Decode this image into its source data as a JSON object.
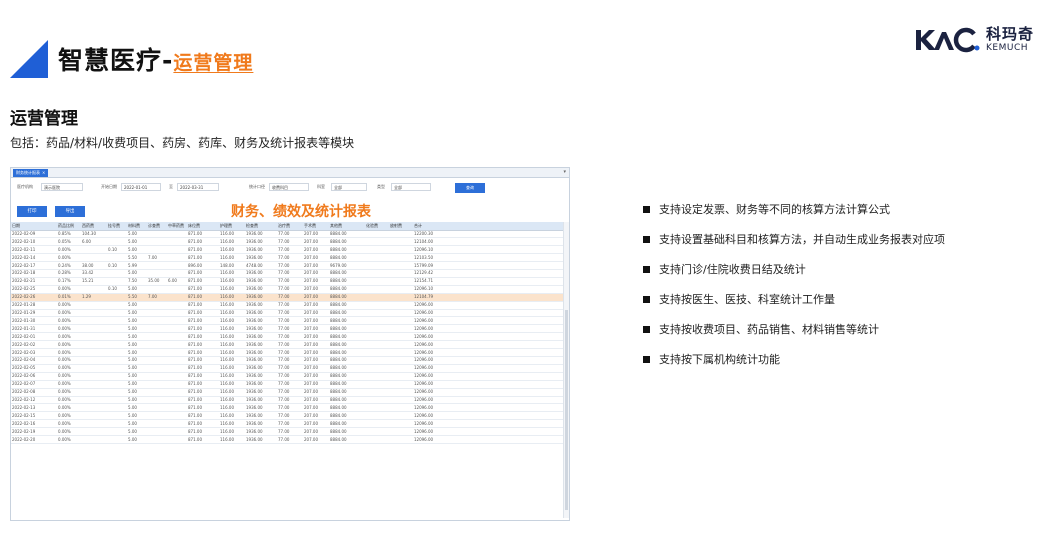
{
  "header": {
    "title": "智慧医疗-",
    "subtitle": "运营管理"
  },
  "logo": {
    "cn": "科玛奇",
    "en": "KEMUCH"
  },
  "section": {
    "title": "运营管理",
    "description": "包括：药品/材料/收费项目、药房、药库、财务及统计报表等模块"
  },
  "screenshot": {
    "tab_label": "财务统计报表",
    "filters": [
      {
        "label": "医疗机构",
        "value": "演示医院"
      },
      {
        "label": "开始日期",
        "value": "2022-01-01"
      },
      {
        "label": "至",
        "value": "2022-03-31"
      },
      {
        "label": "统计口径",
        "value": "收费科目"
      },
      {
        "label": "科室",
        "value": "全部"
      },
      {
        "label": "类型",
        "value": "全部"
      }
    ],
    "query_label": "查询",
    "print_label": "打印",
    "export_label": "导出",
    "overlay_title": "财务、绩效及统计报表",
    "columns": [
      "日期",
      "药品比例",
      "西药费",
      "挂号费",
      "材料费",
      "诊查费",
      "中草药费",
      "床位费",
      "护理费",
      "检查费",
      "治疗费",
      "手术费",
      "其他费",
      "化验费",
      "放射费",
      "合计"
    ],
    "rows": [
      [
        "2022-02-09",
        "0.85%",
        "104.30",
        "",
        "5.00",
        "",
        "",
        "871.00",
        "116.00",
        "1936.00",
        "77.00",
        "207.00",
        "8884.00",
        "",
        "",
        "12200.30"
      ],
      [
        "2022-02-10",
        "0.05%",
        "6.00",
        "",
        "5.00",
        "",
        "",
        "871.00",
        "116.00",
        "1936.00",
        "77.00",
        "207.00",
        "8884.00",
        "",
        "",
        "12104.00"
      ],
      [
        "2022-02-11",
        "0.00%",
        "",
        "0.10",
        "5.00",
        "",
        "",
        "871.00",
        "116.00",
        "1936.00",
        "77.00",
        "207.00",
        "8884.00",
        "",
        "",
        "12096.10"
      ],
      [
        "2022-02-14",
        "0.00%",
        "",
        "",
        "5.50",
        "7.00",
        "",
        "871.00",
        "116.00",
        "1936.00",
        "77.00",
        "207.00",
        "8884.00",
        "",
        "",
        "12103.50"
      ],
      [
        "2022-02-17",
        "0.24%",
        "38.00",
        "0.10",
        "5.99",
        "",
        "",
        "896.00",
        "148.00",
        "4748.00",
        "77.00",
        "207.00",
        "9679.00",
        "",
        "",
        "15799.09"
      ],
      [
        "2022-02-18",
        "0.28%",
        "33.42",
        "",
        "5.00",
        "",
        "",
        "871.00",
        "116.00",
        "1936.00",
        "77.00",
        "207.00",
        "8884.00",
        "",
        "",
        "12129.42"
      ],
      [
        "2022-02-21",
        "0.17%",
        "15.21",
        "",
        "7.50",
        "35.00",
        "6.00",
        "871.00",
        "116.00",
        "1936.00",
        "77.00",
        "207.00",
        "8884.00",
        "",
        "",
        "12154.71"
      ],
      [
        "2022-02-25",
        "0.00%",
        "",
        "0.10",
        "5.00",
        "",
        "",
        "871.00",
        "116.00",
        "1936.00",
        "77.00",
        "207.00",
        "8884.00",
        "",
        "",
        "12096.10"
      ],
      [
        "2022-02-26",
        "0.01%",
        "1.29",
        "",
        "5.50",
        "7.00",
        "",
        "871.00",
        "116.00",
        "1936.00",
        "77.00",
        "207.00",
        "8884.00",
        "",
        "",
        "12104.79"
      ],
      [
        "2022-01-28",
        "0.00%",
        "",
        "",
        "5.00",
        "",
        "",
        "871.00",
        "116.00",
        "1936.00",
        "77.00",
        "207.00",
        "8884.00",
        "",
        "",
        "12096.00"
      ],
      [
        "2022-01-29",
        "0.00%",
        "",
        "",
        "5.00",
        "",
        "",
        "871.00",
        "116.00",
        "1936.00",
        "77.00",
        "207.00",
        "8884.00",
        "",
        "",
        "12096.00"
      ],
      [
        "2022-01-30",
        "0.00%",
        "",
        "",
        "5.00",
        "",
        "",
        "871.00",
        "116.00",
        "1936.00",
        "77.00",
        "207.00",
        "8884.00",
        "",
        "",
        "12096.00"
      ],
      [
        "2022-01-31",
        "0.00%",
        "",
        "",
        "5.00",
        "",
        "",
        "871.00",
        "116.00",
        "1936.00",
        "77.00",
        "207.00",
        "8884.00",
        "",
        "",
        "12096.00"
      ],
      [
        "2022-02-01",
        "0.00%",
        "",
        "",
        "5.00",
        "",
        "",
        "871.00",
        "116.00",
        "1936.00",
        "77.00",
        "207.00",
        "8884.00",
        "",
        "",
        "12096.00"
      ],
      [
        "2022-02-02",
        "0.00%",
        "",
        "",
        "5.00",
        "",
        "",
        "871.00",
        "116.00",
        "1936.00",
        "77.00",
        "207.00",
        "8884.00",
        "",
        "",
        "12096.00"
      ],
      [
        "2022-02-03",
        "0.00%",
        "",
        "",
        "5.00",
        "",
        "",
        "871.00",
        "116.00",
        "1936.00",
        "77.00",
        "207.00",
        "8884.00",
        "",
        "",
        "12096.00"
      ],
      [
        "2022-02-04",
        "0.00%",
        "",
        "",
        "5.00",
        "",
        "",
        "871.00",
        "116.00",
        "1936.00",
        "77.00",
        "207.00",
        "8884.00",
        "",
        "",
        "12096.00"
      ],
      [
        "2022-02-05",
        "0.00%",
        "",
        "",
        "5.00",
        "",
        "",
        "871.00",
        "116.00",
        "1936.00",
        "77.00",
        "207.00",
        "8884.00",
        "",
        "",
        "12096.00"
      ],
      [
        "2022-02-06",
        "0.00%",
        "",
        "",
        "5.00",
        "",
        "",
        "871.00",
        "116.00",
        "1936.00",
        "77.00",
        "207.00",
        "8884.00",
        "",
        "",
        "12096.00"
      ],
      [
        "2022-02-07",
        "0.00%",
        "",
        "",
        "5.00",
        "",
        "",
        "871.00",
        "116.00",
        "1936.00",
        "77.00",
        "207.00",
        "8884.00",
        "",
        "",
        "12096.00"
      ],
      [
        "2022-02-08",
        "0.00%",
        "",
        "",
        "5.00",
        "",
        "",
        "871.00",
        "116.00",
        "1936.00",
        "77.00",
        "207.00",
        "8884.00",
        "",
        "",
        "12096.00"
      ],
      [
        "2022-02-12",
        "0.00%",
        "",
        "",
        "5.00",
        "",
        "",
        "871.00",
        "116.00",
        "1936.00",
        "77.00",
        "207.00",
        "8884.00",
        "",
        "",
        "12096.00"
      ],
      [
        "2022-02-13",
        "0.00%",
        "",
        "",
        "5.00",
        "",
        "",
        "871.00",
        "116.00",
        "1936.00",
        "77.00",
        "207.00",
        "8884.00",
        "",
        "",
        "12096.00"
      ],
      [
        "2022-02-15",
        "0.00%",
        "",
        "",
        "5.00",
        "",
        "",
        "871.00",
        "116.00",
        "1936.00",
        "77.00",
        "207.00",
        "8884.00",
        "",
        "",
        "12096.00"
      ],
      [
        "2022-02-16",
        "0.00%",
        "",
        "",
        "5.00",
        "",
        "",
        "871.00",
        "116.00",
        "1936.00",
        "77.00",
        "207.00",
        "8884.00",
        "",
        "",
        "12096.00"
      ],
      [
        "2022-02-19",
        "0.00%",
        "",
        "",
        "5.00",
        "",
        "",
        "871.00",
        "116.00",
        "1936.00",
        "77.00",
        "207.00",
        "8884.00",
        "",
        "",
        "12096.00"
      ],
      [
        "2022-02-20",
        "0.00%",
        "",
        "",
        "5.00",
        "",
        "",
        "871.00",
        "116.00",
        "1936.00",
        "77.00",
        "207.00",
        "8884.00",
        "",
        "",
        "12096.00"
      ]
    ],
    "highlight_row": 8
  },
  "features": [
    "支持设定发票、财务等不同的核算方法计算公式",
    "支持设置基础科目和核算方法，并自动生成业务报表对应项",
    "支持门诊/住院收费日结及统计",
    "支持按医生、医技、科室统计工作量",
    "支持按收费项目、药品销售、材料销售等统计",
    "支持按下属机构统计功能"
  ],
  "colors": {
    "accent_blue": "#1f5fd6",
    "accent_orange": "#f07a1c",
    "row_highlight": "#fbe3cc"
  }
}
